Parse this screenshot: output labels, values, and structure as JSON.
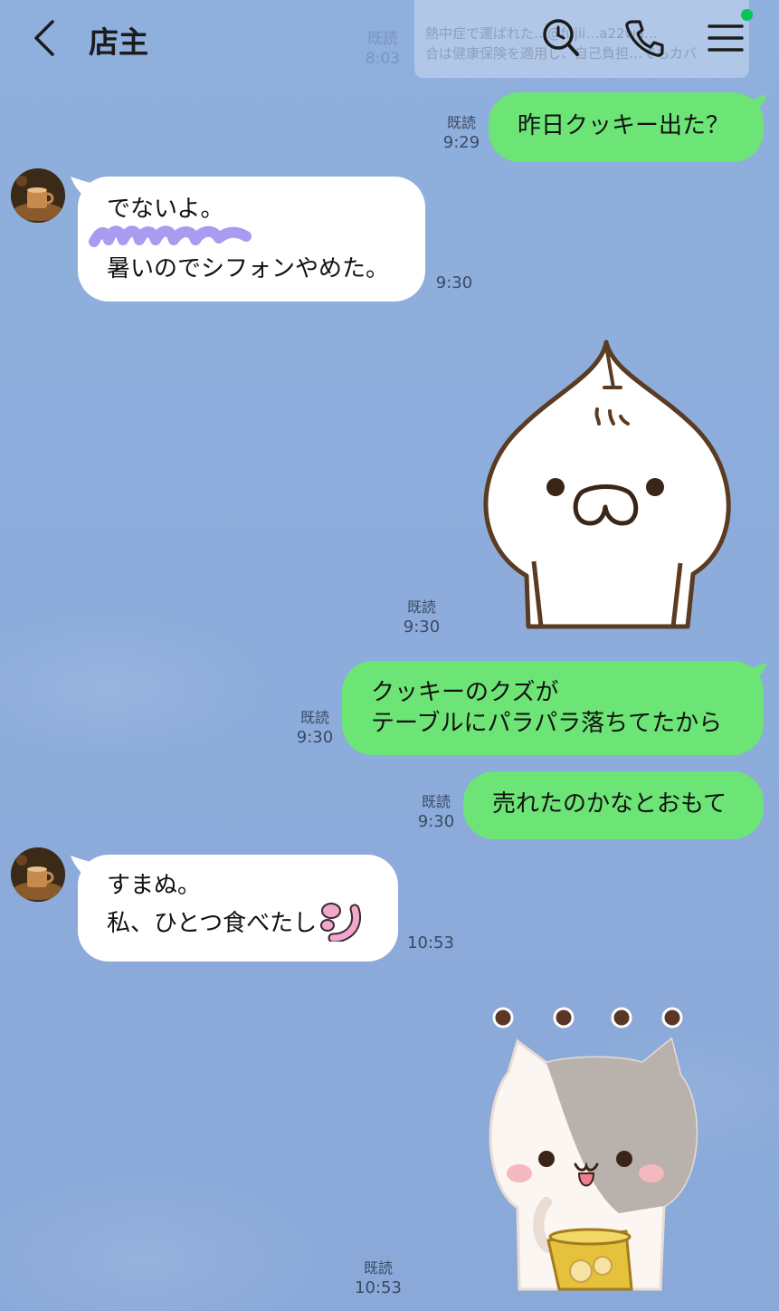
{
  "header": {
    "back_label": "<",
    "title": "店主",
    "search_icon": "search-icon",
    "call_icon": "phone-icon",
    "menu_icon": "menu-icon",
    "notification_color": "#06c755"
  },
  "pinned_notice": {
    "line1": "熱中症で運ばれた…@fujii…a22wa…",
    "line2": "合は健康保険を適用し、自己負担…でもカバ"
  },
  "ghost_meta": {
    "read": "既読",
    "time": "8:03"
  },
  "messages": [
    {
      "side": "me",
      "lines": [
        "昨日クッキー出た？"
      ],
      "read": "既読",
      "time": "9:29"
    },
    {
      "side": "them",
      "lines": [
        "でないよ。",
        "",
        "暑いのでシフォンやめた。"
      ],
      "time": "9:30"
    },
    {
      "side": "me",
      "type": "sticker",
      "sticker": "onion-cat-sticker",
      "read": "既読",
      "time": "9:30"
    },
    {
      "side": "me",
      "lines": [
        "クッキーのクズが",
        "テーブルにパラパラ落ちてたから"
      ],
      "read": "既読",
      "time": "9:30"
    },
    {
      "side": "me",
      "lines": [
        "売れたのかなとおもて"
      ],
      "read": "既読",
      "time": "9:30"
    },
    {
      "side": "them",
      "lines": [
        "すまぬ。",
        "私、ひとつ食べたし"
      ],
      "time": "10:53"
    },
    {
      "side": "me",
      "type": "sticker",
      "sticker": "gray-cat-cookie-sticker",
      "read": "既読",
      "time": "10:53"
    }
  ],
  "colors": {
    "background": "#8eaedc",
    "my_bubble": "#6de476",
    "their_bubble": "#ffffff",
    "scribble": "#a99cf0"
  }
}
